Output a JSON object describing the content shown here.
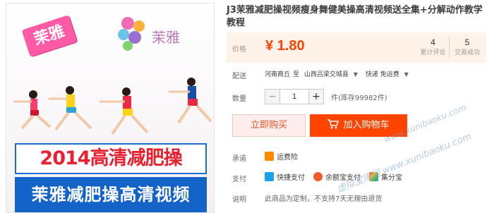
{
  "image": {
    "brand_badge": "茉雅",
    "logo_text": "茉雅",
    "banner_top": "2014高清减肥操",
    "banner_bottom": "茉雅减肥操高清视频"
  },
  "product": {
    "title": "J3茉雅减肥操视频瘦身舞健美操高清视频送全集+分解动作教学教程",
    "price_label": "价格",
    "price": "¥ 1.80",
    "stats": [
      {
        "value": "4",
        "label": "累计评论"
      },
      {
        "value": "5",
        "label": "交易成功"
      }
    ]
  },
  "delivery": {
    "label": "配送",
    "origin": "河南商丘",
    "to": "至",
    "destination": "山西吕梁交城县",
    "express": "快递 免运费"
  },
  "quantity": {
    "label": "数量",
    "minus": "−",
    "value": "1",
    "plus": "+",
    "stock": "件(库存99982件)"
  },
  "actions": {
    "buy_now": "立即购买",
    "add_cart": "加入购物车"
  },
  "promise": {
    "label": "承诺",
    "item": "运费险"
  },
  "payment": {
    "label": "支付",
    "items": [
      "快捷支付",
      "余额宝支付",
      "集分宝"
    ]
  },
  "notice": {
    "label": "说明",
    "text": "此商品为定制，不支持7天无理由退货"
  },
  "watermarks": [
    "www.xunibaoku.com",
    "虚拟宝库网 www.xunibaoku.com"
  ],
  "colors": {
    "accent": "#ff4400",
    "price": "#ff4400",
    "price_bg": "#fff2e8",
    "buy_now_bg": "#ffeded"
  }
}
